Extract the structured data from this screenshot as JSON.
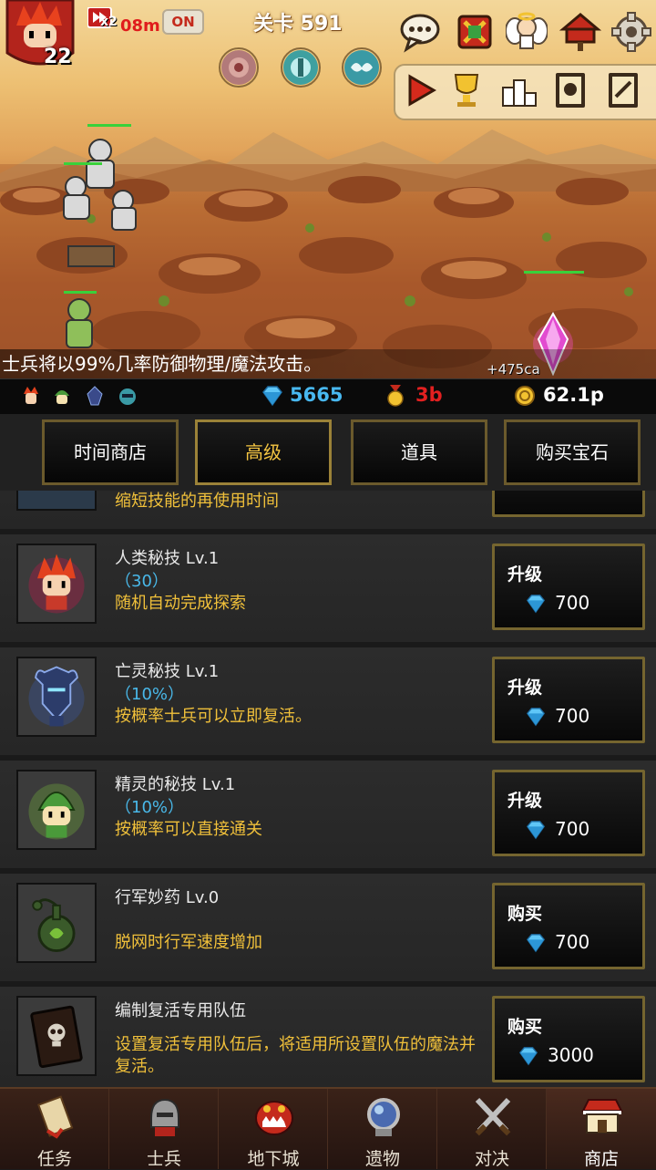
{
  "hud": {
    "player_level": "22",
    "speed_multiplier": "x2",
    "boost_timer": "08m",
    "auto_toggle": "ON",
    "stage_label": "关卡 591"
  },
  "battle": {
    "hint_text": "士兵将以99%几率防御物理/魔法攻击。",
    "gain_text": "+475ca"
  },
  "resources": {
    "gems": "5665",
    "medals": "3b",
    "gold": "62.1p",
    "colors": {
      "gems": "#48b8f0",
      "medals": "#e22020",
      "gold": "#ffffff"
    }
  },
  "tabs": [
    {
      "label": "时间商店",
      "active": false
    },
    {
      "label": "高级",
      "active": true
    },
    {
      "label": "道具",
      "active": false
    },
    {
      "label": "购买宝石",
      "active": false
    }
  ],
  "shop": {
    "partial_desc": "缩短技能的再使用时间",
    "items": [
      {
        "title": "人类秘技 Lv.1",
        "pct": "（30）",
        "desc": "随机自动完成探索",
        "btn": "升级",
        "price": "700",
        "icon": "human-hero-icon"
      },
      {
        "title": "亡灵秘技 Lv.1",
        "pct": "（10%）",
        "desc": "按概率士兵可以立即复活。",
        "btn": "升级",
        "price": "700",
        "icon": "undead-knight-icon"
      },
      {
        "title": "精灵的秘技 Lv.1",
        "pct": "（10%）",
        "desc": "按概率可以直接通关",
        "btn": "升级",
        "price": "700",
        "icon": "elf-icon"
      },
      {
        "title": "行军妙药 Lv.0",
        "pct": "",
        "desc": "脱网时行军速度增加",
        "btn": "购买",
        "price": "700",
        "icon": "potion-icon"
      },
      {
        "title": "编制复活专用队伍",
        "pct": "",
        "desc": "设置复活专用队伍后，将适用所设置队伍的魔法并复活。",
        "btn": "购买",
        "price": "3000",
        "icon": "skull-book-icon"
      }
    ]
  },
  "nav": [
    {
      "label": "任务",
      "icon": "scroll-icon",
      "active": false
    },
    {
      "label": "士兵",
      "icon": "helmet-icon",
      "active": false
    },
    {
      "label": "地下城",
      "icon": "monster-icon",
      "active": false
    },
    {
      "label": "遗物",
      "icon": "orb-icon",
      "active": false
    },
    {
      "label": "对决",
      "icon": "crossed-swords-icon",
      "active": false
    },
    {
      "label": "商店",
      "icon": "shop-icon",
      "active": true
    }
  ],
  "colors": {
    "accent_gold": "#f0c03a",
    "percent_blue": "#49b8e9",
    "timer_red": "#e01c1c"
  }
}
